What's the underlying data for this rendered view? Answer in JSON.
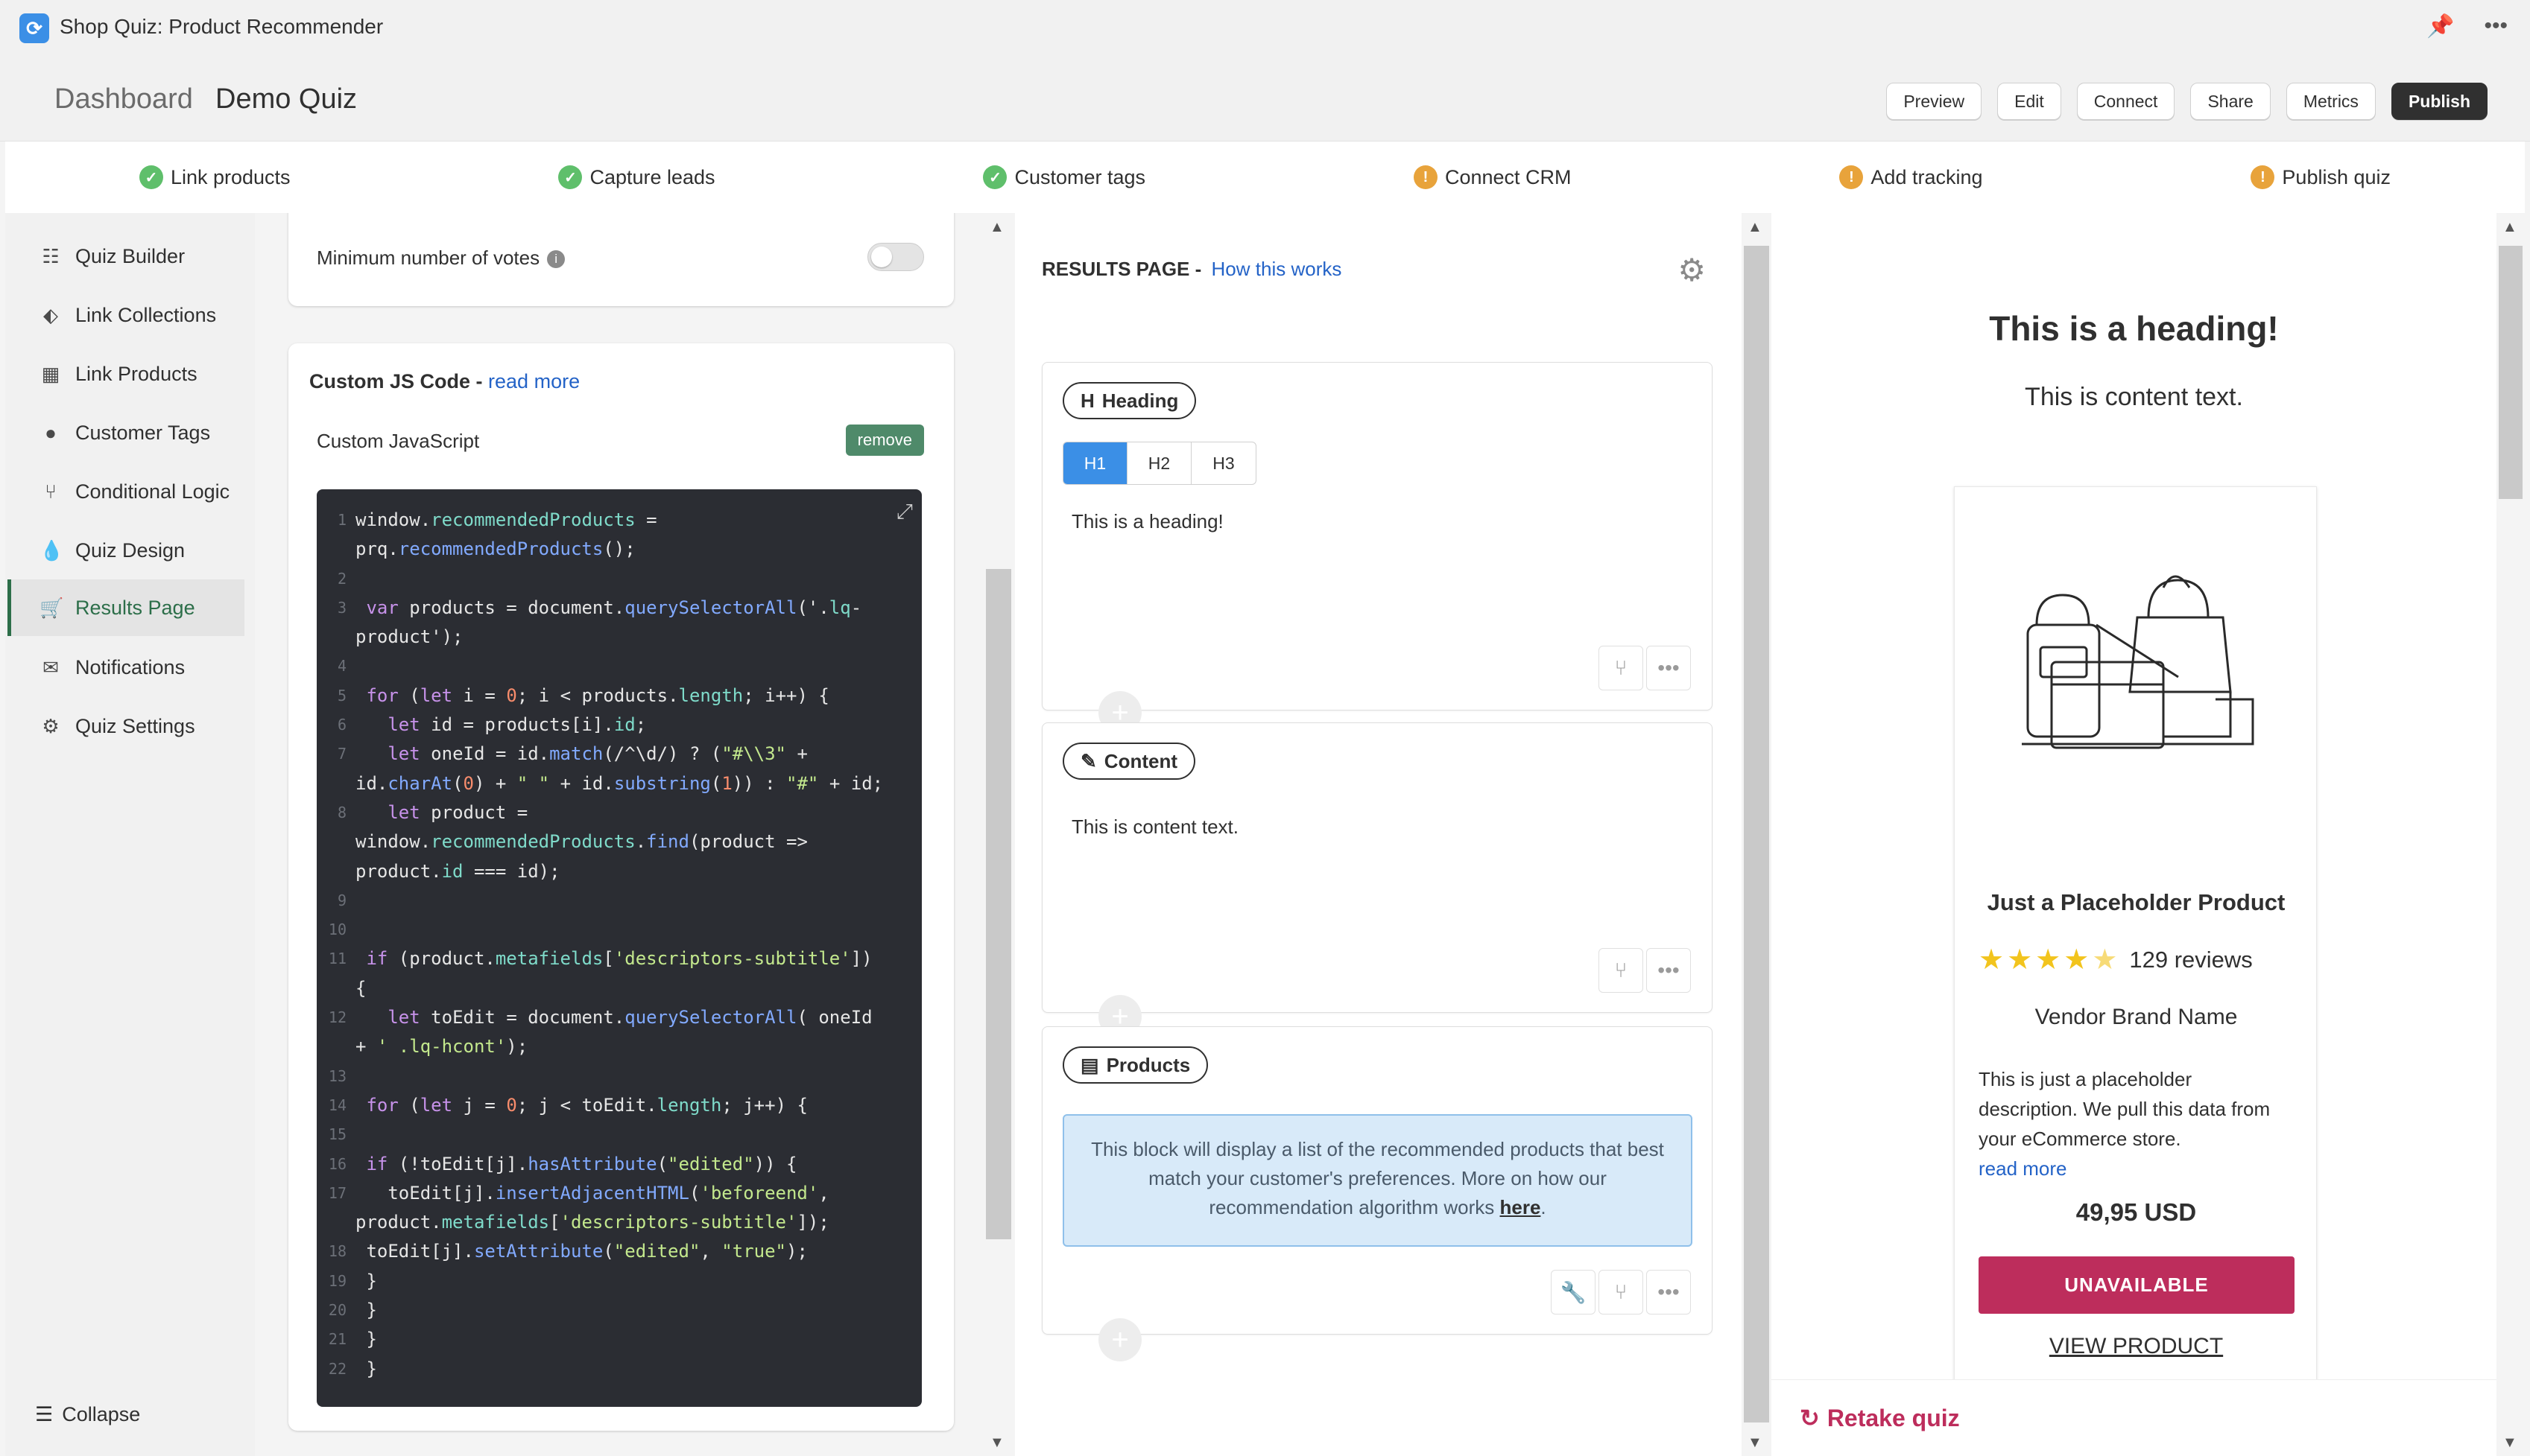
{
  "app": {
    "title": "Shop Quiz: Product Recommender"
  },
  "header": {
    "breadcrumb_parent": "Dashboard",
    "breadcrumb_current": "Demo Quiz",
    "buttons": [
      "Preview",
      "Edit",
      "Connect",
      "Share",
      "Metrics",
      "Publish"
    ]
  },
  "steps": [
    {
      "label": "Link products",
      "status": "done"
    },
    {
      "label": "Capture leads",
      "status": "done"
    },
    {
      "label": "Customer tags",
      "status": "done"
    },
    {
      "label": "Connect CRM",
      "status": "pending"
    },
    {
      "label": "Add tracking",
      "status": "pending"
    },
    {
      "label": "Publish quiz",
      "status": "pending"
    }
  ],
  "sidebar": {
    "items": [
      {
        "label": "Quiz Builder",
        "icon": "list-icon"
      },
      {
        "label": "Link Collections",
        "icon": "tag-icon"
      },
      {
        "label": "Link Products",
        "icon": "box-icon"
      },
      {
        "label": "Customer Tags",
        "icon": "user-icon"
      },
      {
        "label": "Conditional Logic",
        "icon": "branch-icon"
      },
      {
        "label": "Quiz Design",
        "icon": "droplet-icon"
      },
      {
        "label": "Results Page",
        "icon": "cart-icon",
        "active": true
      },
      {
        "label": "Notifications",
        "icon": "envelope-icon"
      },
      {
        "label": "Quiz Settings",
        "icon": "gear-icon"
      }
    ],
    "collapse_label": "Collapse"
  },
  "settings": {
    "min_votes_label": "Minimum number of votes",
    "custom_js_title": "Custom JS Code - ",
    "read_more": "read more",
    "custom_js_label": "Custom JavaScript",
    "remove_label": "remove",
    "code_lines": [
      {
        "n": "1",
        "t": "window.recommendedProducts ="
      },
      {
        "n": "",
        "t": "prq.recommendedProducts();"
      },
      {
        "n": "2",
        "t": ""
      },
      {
        "n": "3",
        "t": " var products = document.querySelectorAll('.lq-"
      },
      {
        "n": "",
        "t": "product');"
      },
      {
        "n": "4",
        "t": ""
      },
      {
        "n": "5",
        "t": " for (let i = 0; i < products.length; i++) {"
      },
      {
        "n": "6",
        "t": "   let id = products[i].id;"
      },
      {
        "n": "7",
        "t": "   let oneId = id.match(/^\\d/) ? (\"#\\\\3\" +"
      },
      {
        "n": "",
        "t": "id.charAt(0) + \" \" + id.substring(1)) : \"#\" + id;"
      },
      {
        "n": "8",
        "t": "   let product ="
      },
      {
        "n": "",
        "t": "window.recommendedProducts.find(product =>"
      },
      {
        "n": "",
        "t": "product.id === id);"
      },
      {
        "n": "9",
        "t": ""
      },
      {
        "n": "10",
        "t": ""
      },
      {
        "n": "11",
        "t": " if (product.metafields['descriptors-subtitle'])"
      },
      {
        "n": "",
        "t": "{"
      },
      {
        "n": "12",
        "t": "   let toEdit = document.querySelectorAll( oneId"
      },
      {
        "n": "",
        "t": "+ ' .lq-hcont');"
      },
      {
        "n": "13",
        "t": ""
      },
      {
        "n": "14",
        "t": " for (let j = 0; j < toEdit.length; j++) {"
      },
      {
        "n": "15",
        "t": ""
      },
      {
        "n": "16",
        "t": " if (!toEdit[j].hasAttribute(\"edited\")) {"
      },
      {
        "n": "17",
        "t": "   toEdit[j].insertAdjacentHTML('beforeend',"
      },
      {
        "n": "",
        "t": "product.metafields['descriptors-subtitle']);"
      },
      {
        "n": "18",
        "t": " toEdit[j].setAttribute(\"edited\", \"true\");"
      },
      {
        "n": "19",
        "t": " }"
      },
      {
        "n": "20",
        "t": " }"
      },
      {
        "n": "21",
        "t": " }"
      },
      {
        "n": "22",
        "t": " }"
      }
    ]
  },
  "results": {
    "title": "RESULTS PAGE",
    "sep": "-",
    "how_link": "How this works",
    "heading_block": {
      "label": "Heading",
      "tabs": [
        "H1",
        "H2",
        "H3"
      ],
      "selected": "H1",
      "text": "This is a heading!"
    },
    "content_block": {
      "label": "Content",
      "text": "This is content text."
    },
    "products_block": {
      "label": "Products",
      "info": "This block will display a list of the recommended products that best match your customer's preferences. More on how our recommendation algorithm works ",
      "info_link": "here",
      "info_end": "."
    }
  },
  "preview": {
    "heading": "This is a heading!",
    "content": "This is content text.",
    "product": {
      "name": "Just a Placeholder Product",
      "rating": 4.5,
      "reviews": "129 reviews",
      "vendor": "Vendor Brand Name",
      "description": "This is just a placeholder description. We pull this data from your eCommerce store.",
      "read_more": "read more",
      "price": "49,95 USD",
      "button": "UNAVAILABLE",
      "view": "VIEW PRODUCT"
    },
    "retake": "Retake quiz"
  },
  "colors": {
    "accent": "#3b8fe6",
    "active_nav": "#2c6e49",
    "brand_pink": "#bd2d5c",
    "success": "#5fbf6b",
    "warning": "#e8a33b"
  }
}
